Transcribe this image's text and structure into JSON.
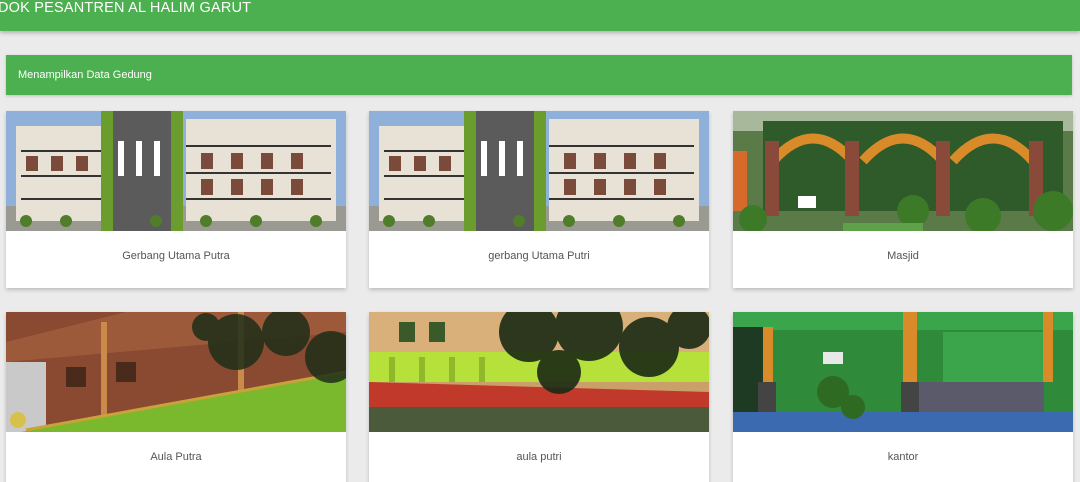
{
  "header": {
    "title": "DOK PESANTREN AL HALIM GARUT"
  },
  "banner": {
    "text": "Menampilkan Data Gedung"
  },
  "buildings": [
    {
      "name": "Gerbang Utama Putra"
    },
    {
      "name": "gerbang Utama Putri"
    },
    {
      "name": "Masjid"
    },
    {
      "name": "Aula Putra"
    },
    {
      "name": "aula putri"
    },
    {
      "name": "kantor"
    }
  ],
  "colors": {
    "primary": "#4caf50",
    "background": "#ebebeb",
    "card": "#ffffff",
    "caption_text": "#555555"
  }
}
